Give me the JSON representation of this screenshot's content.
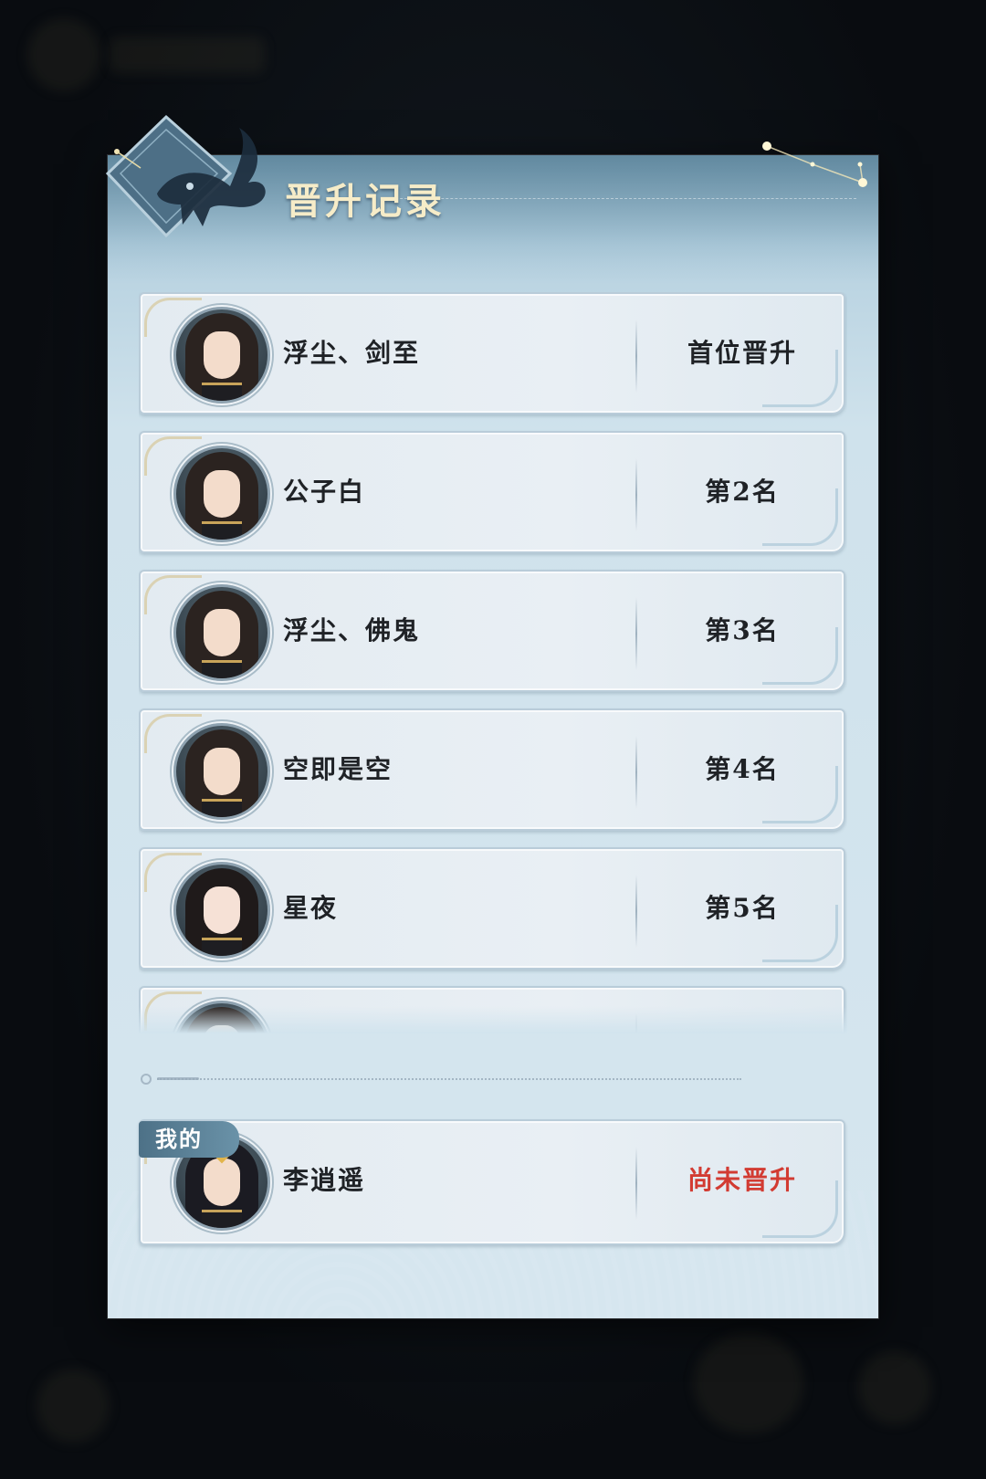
{
  "dialog": {
    "title": "晋升记录"
  },
  "records": [
    {
      "name": "浮尘、剑至",
      "rank": "首位晋升"
    },
    {
      "name": "公子白",
      "rank": "第2名"
    },
    {
      "name": "浮尘、佛鬼",
      "rank": "第3名"
    },
    {
      "name": "空即是空",
      "rank": "第4名"
    },
    {
      "name": "星夜",
      "rank": "第5名"
    }
  ],
  "mine": {
    "tag": "我的",
    "name": "李逍遥",
    "status": "尚未晋升",
    "status_color": "#d23b32"
  },
  "colors": {
    "title": "#f6ecc8",
    "panel": "#cfe2ec",
    "row": "#e6edf2",
    "tag": "#5a8298"
  }
}
